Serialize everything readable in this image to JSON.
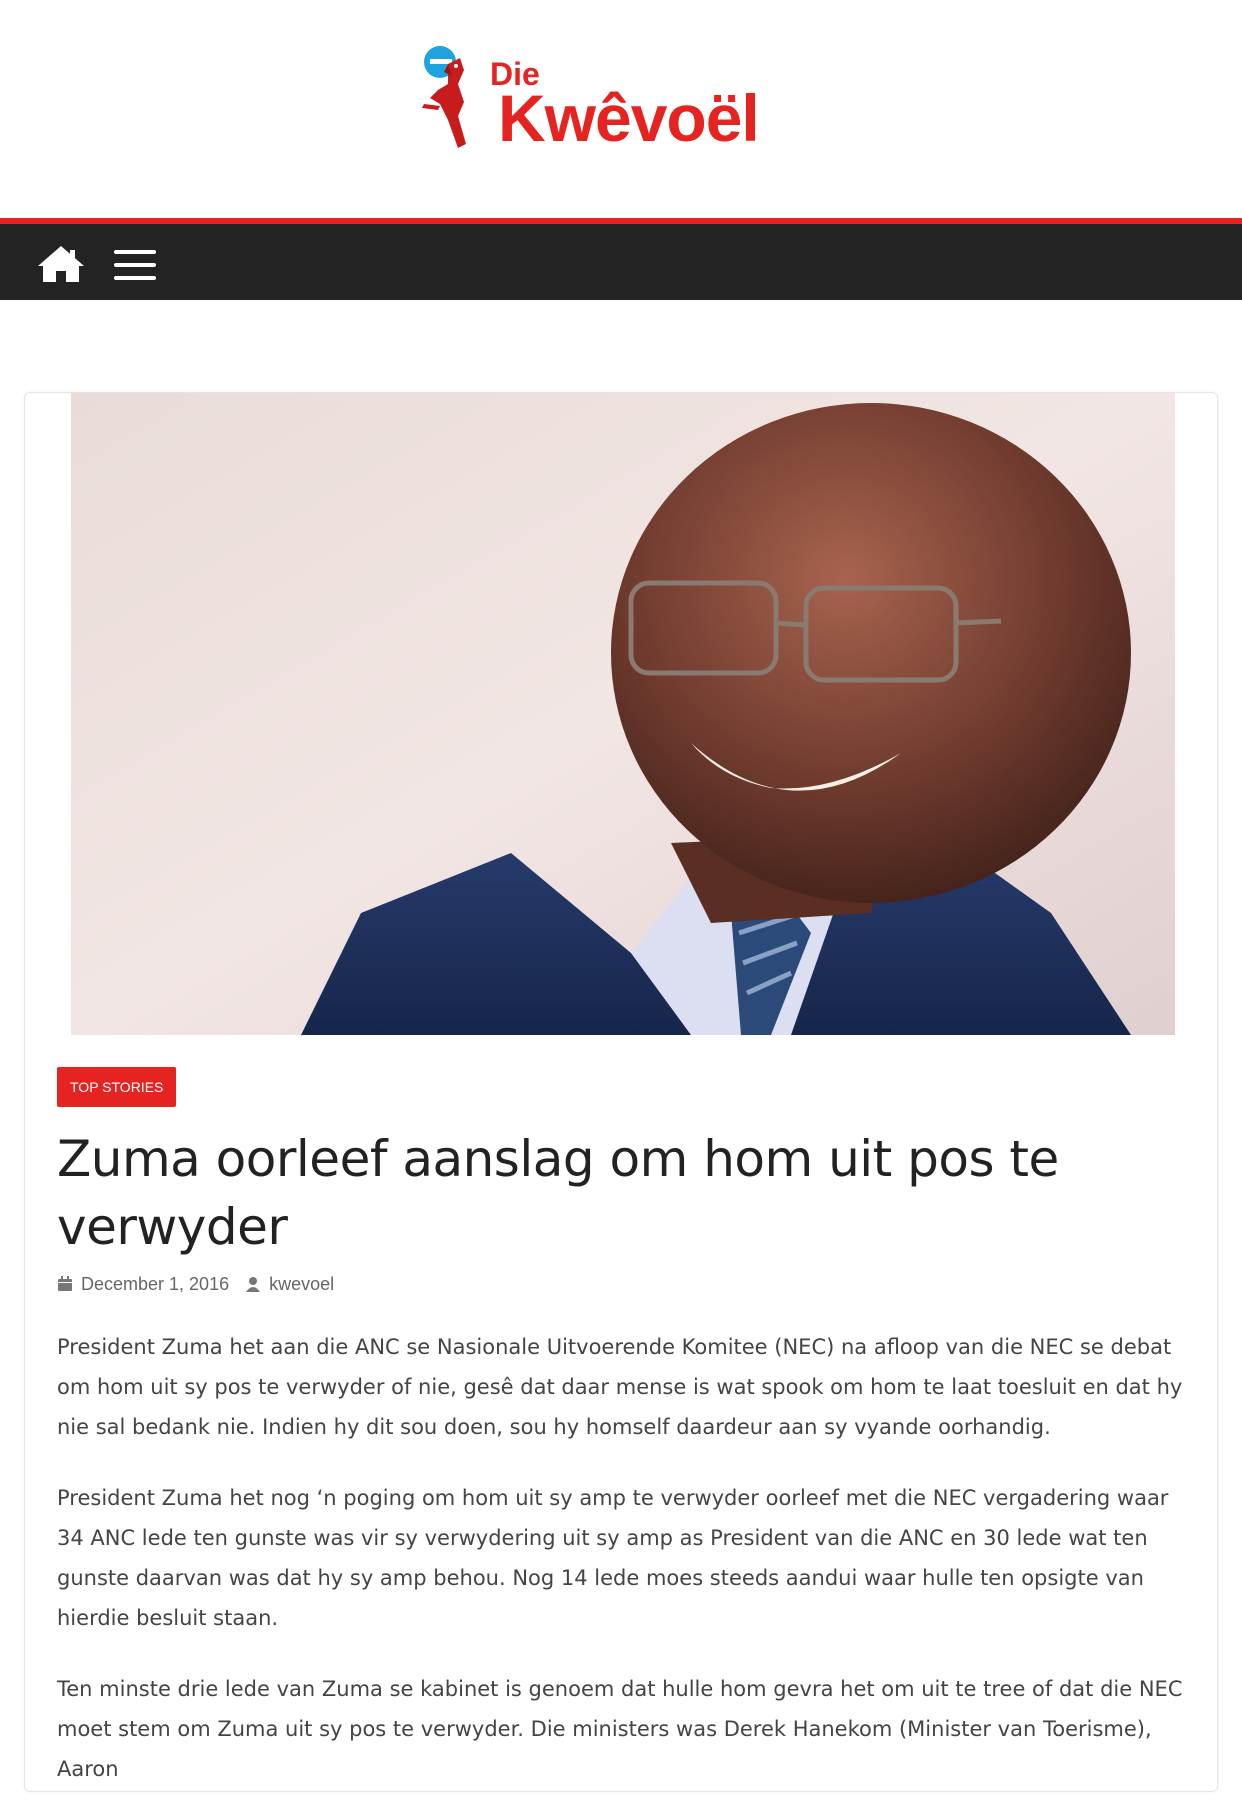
{
  "site": {
    "logo_small": "Die",
    "logo_main": "Kwêvoël",
    "brand_color": "#e52421",
    "nav_bg": "#232323"
  },
  "nav": {
    "home_icon": "home-icon",
    "menu_icon": "hamburger-menu-icon"
  },
  "article": {
    "category": "TOP STORIES",
    "title": "Zuma oorleef aanslag om hom uit pos te verwyder",
    "date": "December 1, 2016",
    "author": "kwevoel",
    "paragraphs": [
      "President Zuma het aan die ANC se Nasionale Uitvoerende Komitee (NEC) na afloop van die NEC se debat om hom uit sy pos te verwyder of nie, gesê dat daar mense is wat spook om hom te laat toesluit en dat hy nie sal bedank nie. Indien hy dit sou doen, sou hy homself daardeur aan sy vyande oorhandig.",
      "President Zuma het nog ‘n poging om hom uit sy amp te verwyder oorleef met die NEC vergadering waar 34 ANC lede ten gunste was vir sy verwydering uit sy amp as President van die ANC en 30 lede wat ten gunste daarvan was dat hy sy amp behou. Nog 14 lede moes steeds aandui waar hulle ten opsigte van hierdie besluit staan.",
      "Ten minste drie lede van Zuma se kabinet is genoem dat hulle hom gevra het om uit te tree of dat die NEC moet stem om Zuma uit sy pos te verwyder. Die ministers was Derek Hanekom (Minister van Toerisme), Aaron"
    ]
  }
}
